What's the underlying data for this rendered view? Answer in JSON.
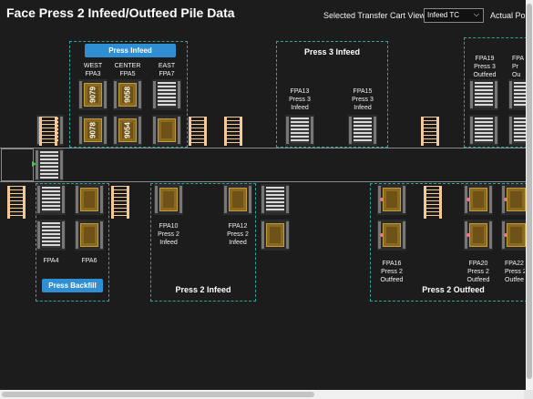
{
  "header": {
    "title": "Face Press 2 Infeed/Outfeed Pile Data",
    "cart_view_label": "Selected Transfer Cart View:",
    "cart_view_value": "Infeed TC",
    "cart_view_chevron": "⌵",
    "actual_pos_label": "Actual Pos"
  },
  "press_infeed": {
    "button": "Press Infeed",
    "west": [
      "WEST",
      "FPA3"
    ],
    "center": [
      "CENTER",
      "FPA5"
    ],
    "east": [
      "EAST",
      "FPA7"
    ],
    "piles": [
      "9079",
      "9058",
      "9078",
      "9054"
    ]
  },
  "press3_infeed": {
    "title": "Press 3 Infeed",
    "fpa13": [
      "FPA13",
      "Press 3",
      "Infeed"
    ],
    "fpa15": [
      "FPA15",
      "Press 3",
      "Infeed"
    ]
  },
  "press3_outfeed": {
    "fpa19": [
      "FPA19",
      "Press 3",
      "Outfeed"
    ],
    "fpa_cut": [
      "FPA",
      "Pr",
      "Ou"
    ]
  },
  "backfill": {
    "button": "Press Backfill",
    "fpa4": "FPA4",
    "fpa6": "FPA6"
  },
  "press2_infeed": {
    "title": "Press 2 Infeed",
    "fpa10": [
      "FPA10",
      "Press 2",
      "Infeed"
    ],
    "fpa12": [
      "FPA12",
      "Press 2",
      "Infeed"
    ]
  },
  "press2_outfeed": {
    "title": "Press 2 Outfeed",
    "fpa16": [
      "FPA16",
      "Press 2",
      "Outfeed"
    ],
    "fpa20": [
      "FPA20",
      "Press 2",
      "Outfeed"
    ],
    "fpa22": [
      "FPA22",
      "Press 2",
      "Outfee"
    ]
  }
}
